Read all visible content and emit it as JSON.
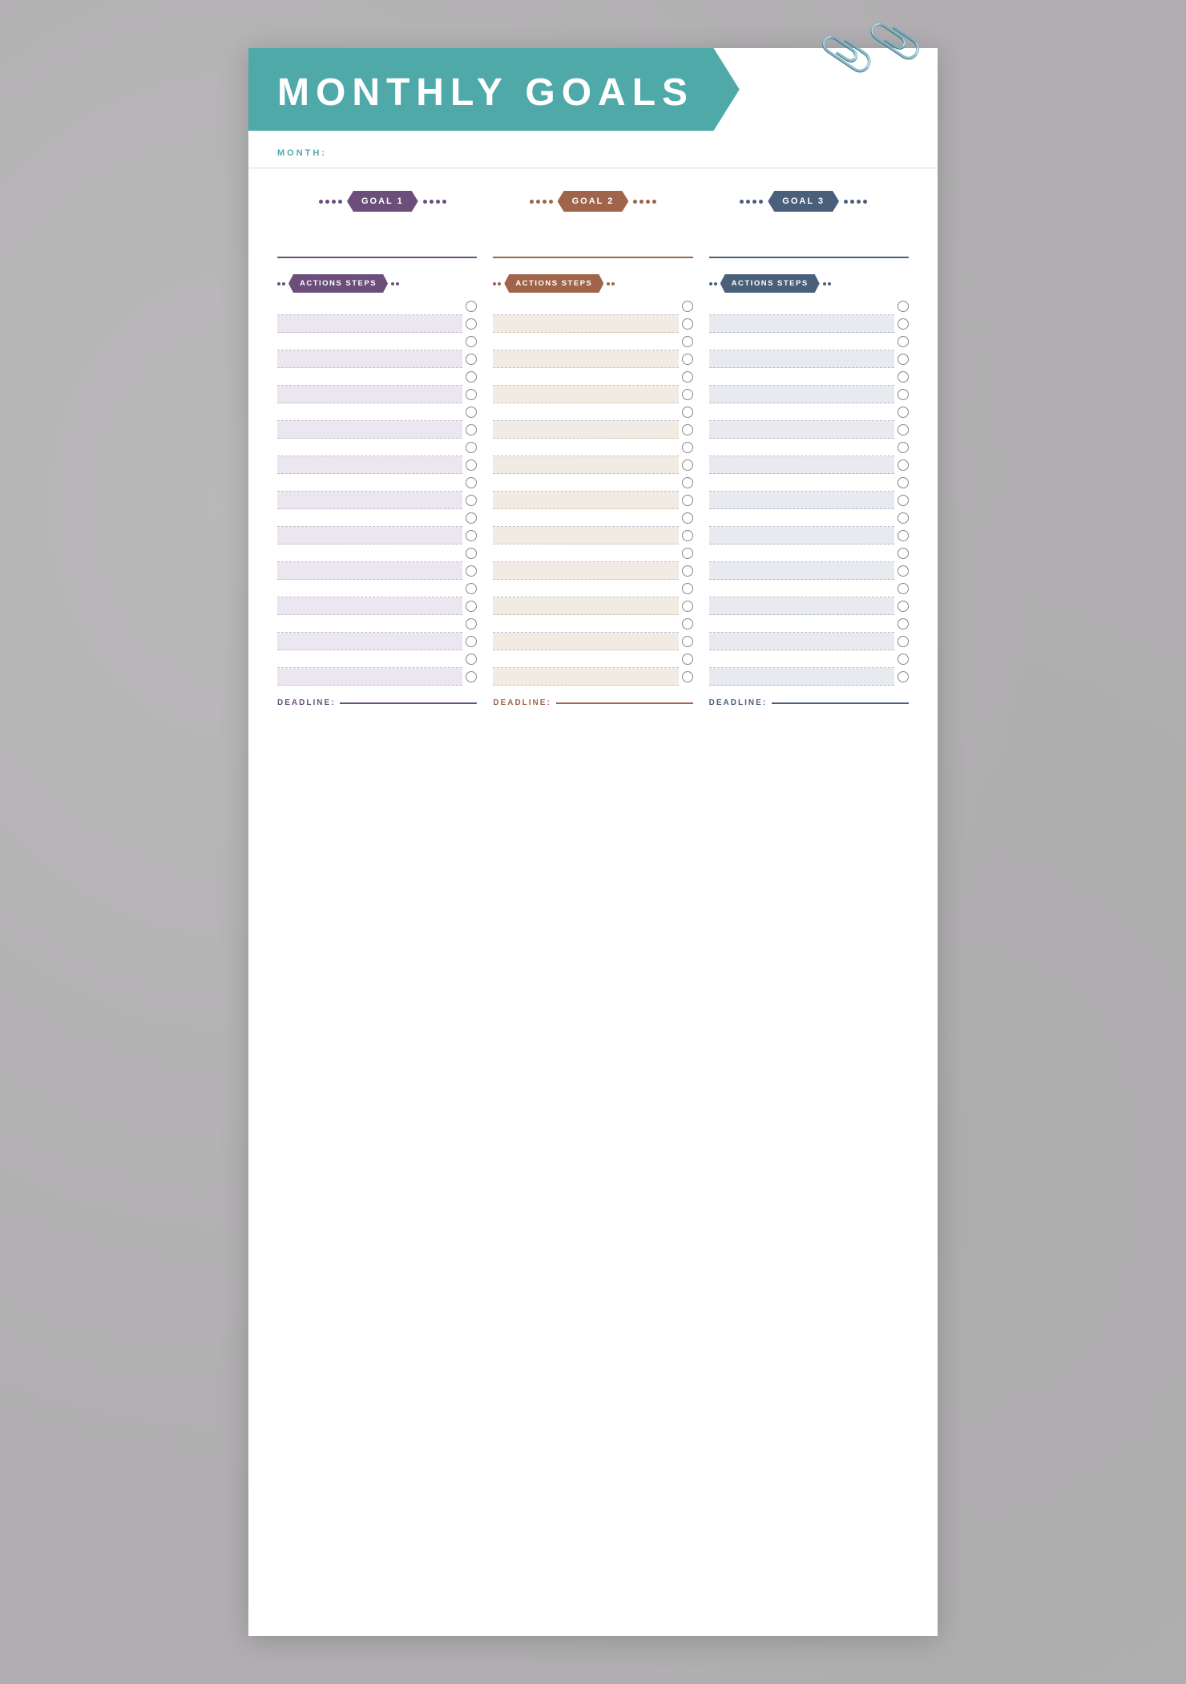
{
  "header": {
    "title": "MONTHLY GOALS",
    "month_label": "MONTH:"
  },
  "goals": [
    {
      "id": 1,
      "label": "GOAL 1",
      "color_class": "goal-banner-1",
      "dot_class": "dot-purple",
      "input_class": "goal-input-block-1",
      "action_banner_class": "action-banner-1",
      "adot_class": "adot-purple",
      "deadline_label_class": "deadline-label-1",
      "deadline_line_class": "deadline-line-1",
      "shaded_class": "shaded"
    },
    {
      "id": 2,
      "label": "GOAL 2",
      "color_class": "goal-banner-2",
      "dot_class": "dot-brown",
      "input_class": "goal-input-block-2",
      "action_banner_class": "action-banner-2",
      "adot_class": "adot-brown",
      "deadline_label_class": "deadline-label-2",
      "deadline_line_class": "deadline-line-2",
      "shaded_class": "shaded-brown"
    },
    {
      "id": 3,
      "label": "GOAL 3",
      "color_class": "goal-banner-3",
      "dot_class": "dot-blue",
      "input_class": "goal-input-block-3",
      "action_banner_class": "action-banner-3",
      "adot_class": "adot-blue",
      "deadline_label_class": "deadline-label-3",
      "deadline_line_class": "deadline-line-3",
      "shaded_class": "shaded-blue"
    }
  ],
  "actions_label": "ACTIONS STEPS",
  "deadline_label": "DEADLINE:",
  "step_count": 22
}
